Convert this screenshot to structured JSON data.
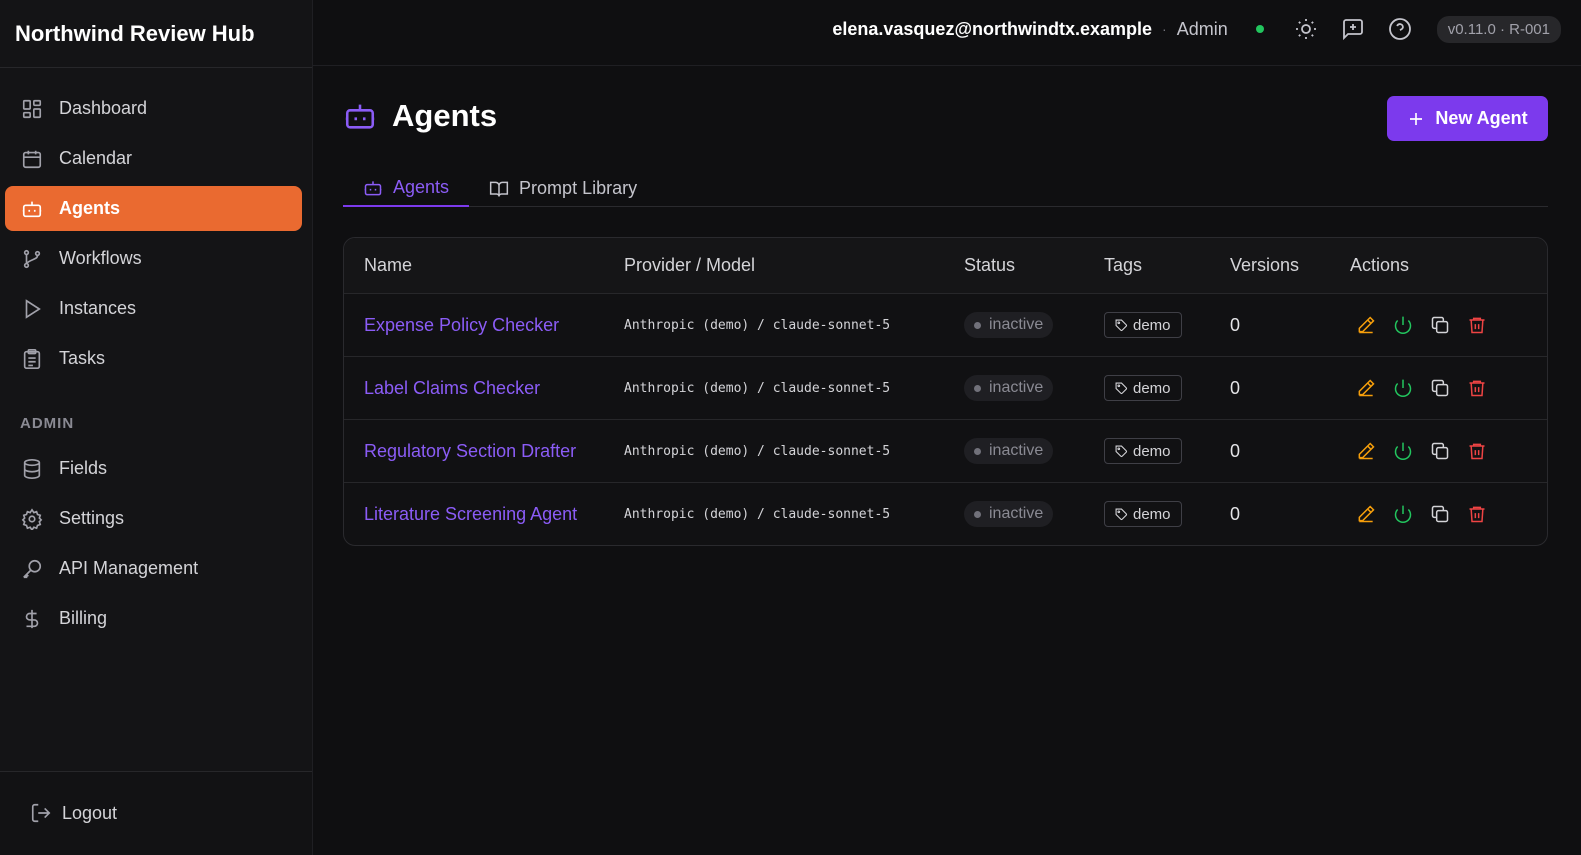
{
  "app": {
    "title": "Northwind Review Hub"
  },
  "header": {
    "user_email": "elena.vasquez@northwindtx.example",
    "separator": "·",
    "user_role": "Admin",
    "version": "v0.11.0 · R-001",
    "status_color": "#22c55e"
  },
  "sidebar": {
    "items": [
      {
        "label": "Dashboard",
        "icon": "dashboard-icon"
      },
      {
        "label": "Calendar",
        "icon": "calendar-icon"
      },
      {
        "label": "Agents",
        "icon": "bot-icon",
        "active": true
      },
      {
        "label": "Workflows",
        "icon": "workflow-icon"
      },
      {
        "label": "Instances",
        "icon": "play-icon"
      },
      {
        "label": "Tasks",
        "icon": "clipboard-icon"
      }
    ],
    "admin_label": "ADMIN",
    "admin_items": [
      {
        "label": "Fields",
        "icon": "database-icon"
      },
      {
        "label": "Settings",
        "icon": "gear-icon"
      },
      {
        "label": "API Management",
        "icon": "key-icon"
      },
      {
        "label": "Billing",
        "icon": "dollar-icon"
      }
    ],
    "logout_label": "Logout",
    "active_color": "#ea6a30"
  },
  "page": {
    "title": "Agents",
    "new_button": "New Agent",
    "accent_color": "#7c3aed",
    "tabs": [
      {
        "label": "Agents",
        "active": true
      },
      {
        "label": "Prompt Library",
        "active": false
      }
    ]
  },
  "table": {
    "columns": [
      "Name",
      "Provider / Model",
      "Status",
      "Tags",
      "Versions",
      "Actions"
    ],
    "rows": [
      {
        "name": "Expense Policy Checker",
        "provider": "Anthropic (demo) / claude-sonnet-5",
        "status": "inactive",
        "tag": "demo",
        "versions": "0"
      },
      {
        "name": "Label Claims Checker",
        "provider": "Anthropic (demo) / claude-sonnet-5",
        "status": "inactive",
        "tag": "demo",
        "versions": "0"
      },
      {
        "name": "Regulatory Section Drafter",
        "provider": "Anthropic (demo) / claude-sonnet-5",
        "status": "inactive",
        "tag": "demo",
        "versions": "0"
      },
      {
        "name": "Literature Screening Agent",
        "provider": "Anthropic (demo) / claude-sonnet-5",
        "status": "inactive",
        "tag": "demo",
        "versions": "0"
      }
    ],
    "action_icons": [
      "edit-icon",
      "power-icon",
      "copy-icon",
      "trash-icon"
    ],
    "action_colors": {
      "edit": "#f59e0b",
      "power": "#22c55e",
      "copy": "#d4d4d8",
      "delete": "#ef4444"
    }
  }
}
